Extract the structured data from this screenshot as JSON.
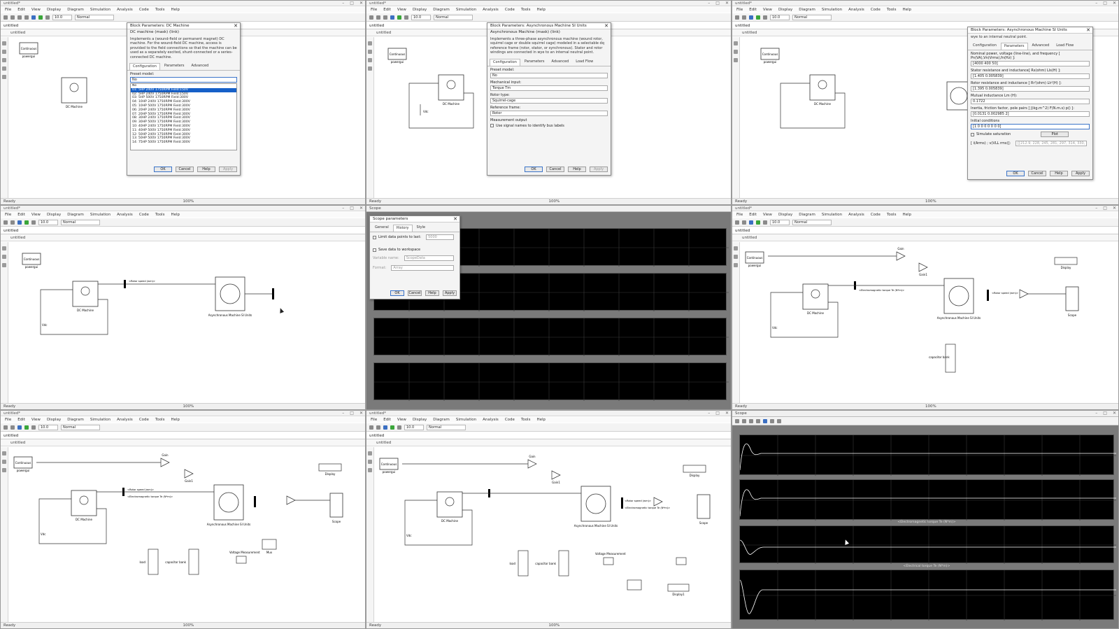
{
  "common": {
    "window_title": "untitled*",
    "menus": [
      "File",
      "Edit",
      "View",
      "Display",
      "Diagram",
      "Simulation",
      "Analysis",
      "Code",
      "Tools",
      "Help"
    ],
    "stop_time": "10.0",
    "sim_mode": "Normal",
    "tab_label": "untitled",
    "path_label": "untitled",
    "status_text": "Ready",
    "zoom_text": "100%"
  },
  "dc_dialog": {
    "title": "Block Parameters: DC Machine",
    "subtitle": "DC machine (mask) (link)",
    "description": "Implements a (wound-field or permanent magnet) DC machine. For the wound-field DC machine, access is provided to the field connections so that the machine can be used as a separately excited, shunt-connected or a series-connected DC machine.",
    "tabs": [
      "Configuration",
      "Parameters",
      "Advanced"
    ],
    "preset_label": "Preset model:",
    "preset_value": "No",
    "options": [
      "No",
      "01: 5HP 240V 1750RPM Field:150V",
      "02: 5HP 240V 1750RPM Field:150V",
      "03: 5HP 500V 1750RPM Field:300V",
      "04: 10HP 240V 1750RPM Field:300V",
      "05: 10HP 500V 1750RPM Field:300V",
      "06: 20HP 240V 1750RPM Field:300V",
      "07: 20HP 500V 1750RPM Field:300V",
      "08: 30HP 240V 1750RPM Field:300V",
      "09: 30HP 500V 1750RPM Field:300V",
      "10: 40HP 240V 1750RPM Field:300V",
      "11: 40HP 500V 1750RPM Field:300V",
      "12: 50HP 240V 1750RPM Field:300V",
      "13: 50HP 500V 1750RPM Field:300V",
      "14: 75HP 500V 1750RPM Field:300V"
    ],
    "buttons": [
      "OK",
      "Cancel",
      "Help",
      "Apply"
    ]
  },
  "async_dialog": {
    "title": "Block Parameters: Asynchronous Machine SI Units",
    "subtitle": "Asynchronous Machine (mask) (link)",
    "description": "Implements a three-phase asynchronous machine (wound rotor, squirrel cage or double squirrel cage) modeled in a selectable dq reference frame (rotor, stator, or synchronous). Stator and rotor windings are connected in wye to an internal neutral point.",
    "tabs": [
      "Configuration",
      "Parameters",
      "Advanced",
      "Load Flow"
    ],
    "fields": [
      {
        "label": "Preset model:",
        "value": "No"
      },
      {
        "label": "Mechanical input:",
        "value": "Torque Tm"
      },
      {
        "label": "Rotor type:",
        "value": "Squirrel-cage"
      },
      {
        "label": "Reference frame:",
        "value": "Rotor"
      }
    ],
    "section": "Measurement output",
    "checkbox": "Use signal names to identify bus labels",
    "buttons": [
      "OK",
      "Cancel",
      "Help",
      "Apply"
    ]
  },
  "params_dialog": {
    "title": "Block Parameters: Asynchronous Machine SI Units",
    "top_text": "wye to an internal neutral point.",
    "tabs": [
      "Configuration",
      "Parameters",
      "Advanced",
      "Load Flow"
    ],
    "fields": [
      {
        "label": "Nominal power, voltage (line-line), and frequency [ Pn(VA),Vn(Vrms),fn(Hz) ]:",
        "value": "[4000 400 50]"
      },
      {
        "label": "Stator resistance and inductance[ Rs(ohm)  Lls(H) ]:",
        "value": "[1.405 0.005839]"
      },
      {
        "label": "Rotor resistance and inductance [ Rr'(ohm)  Llr'(H) ]:",
        "value": "[1.395 0.005839]"
      },
      {
        "label": "Mutual inductance Lm (H):",
        "value": "0.1722"
      },
      {
        "label": "Inertia, friction factor, pole pairs [ J(kg.m^2)  F(N.m.s)  p() ]:",
        "value": "[0.0131 0.002985 2]"
      },
      {
        "label": "Initial conditions",
        "value": "[1 0 0 0 0 0 0 0]"
      }
    ],
    "checkbox": "Simulate saturation",
    "plot_button": "Plot",
    "sat_label": "[ i(Arms) ; v(VLL rms)]:",
    "sat_value": "[[212.9, 228, 245, 281, 297, 314, 330, 346, 362]]",
    "buttons": [
      "OK",
      "Cancel",
      "Help",
      "Apply"
    ]
  },
  "scope_params": {
    "title": "Scope parameters",
    "tabs": [
      "General",
      "History",
      "Style"
    ],
    "limit_label": "Limit data points to last:",
    "limit_value": "5000",
    "save_label": "Save data to workspace",
    "varname_label": "Variable name:",
    "varname_value": "ScopeData",
    "format_label": "Format:",
    "format_value": "Array",
    "buttons": [
      "OK",
      "Cancel",
      "Help",
      "Apply"
    ]
  },
  "scope_window": {
    "title": "Scope",
    "plot_labels": [
      "<Rotor speed (wm)>",
      "<Electromagnetic torque Te (N*m)>",
      "<Electrical torque Te (N*m)>"
    ]
  },
  "blocks": {
    "continuous": "Continuous",
    "powergui": "powergui",
    "dc_machine": "DC Machine",
    "async_machine": "Asynchronous Machine SI Units",
    "gain": "Gain",
    "gain1": "Gain1",
    "display": "Display",
    "display1": "Display1",
    "scope": "Scope",
    "load": "load",
    "capacitor_bank": "capacitor bank",
    "voltage_measurement": "Voltage Measurement",
    "mux": "Mux",
    "vdc": "Vdc",
    "rotor_speed": "<Rotor speed (wm)>",
    "em_torque": "<Electromagnetic torque Te (N*m)>",
    "elec_torque": "<Electrical torque Te (N*m)>"
  }
}
